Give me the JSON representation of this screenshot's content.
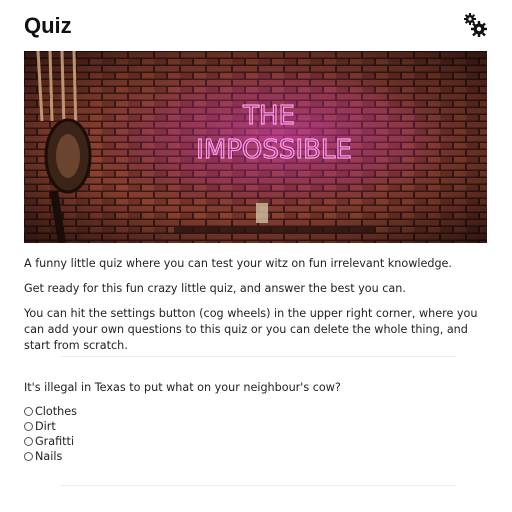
{
  "header": {
    "title": "Quiz",
    "settings_icon": "cog-wheels-icon"
  },
  "hero": {
    "neon_line1": "THE",
    "neon_line2": "IMPOSSIBLE"
  },
  "intro": [
    "A funny little quiz where you can test your witz on fun irrelevant knowledge.",
    "Get ready for this fun crazy little quiz, and answer the best you can.",
    "You can hit the settings button (cog wheels) in the upper right corner, where you can add your own questions to this quiz or you can delete the whole thing, and start from scratch."
  ],
  "question": {
    "text": "It's illegal in Texas to put what on your neighbour's cow?",
    "options": [
      "Clothes",
      "Dirt",
      "Grafitti",
      "Nails"
    ]
  }
}
